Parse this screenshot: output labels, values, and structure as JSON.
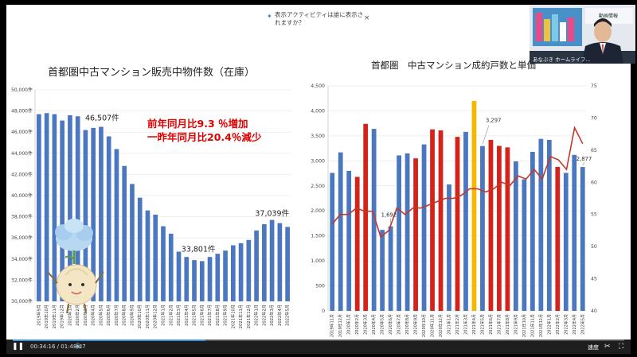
{
  "popup": {
    "text_line1": "表示アクティビティは誰に表示さ",
    "text_line2": "れますか？",
    "close": "×"
  },
  "webcam": {
    "lower_caption": "あなぶき ホームライフ...",
    "screen_text": "動画情報"
  },
  "player": {
    "current_time": "00:34:16",
    "separator": " / ",
    "duration": "01:48:37",
    "speed_label": "速度",
    "progress": 0.315
  },
  "colors": {
    "bar_blue": "#4a77c0",
    "bar_red": "#d3231b",
    "bar_yellow": "#f5b800",
    "line_red": "#c0392b",
    "annotation_red": "#e00000"
  },
  "chart_data": [
    {
      "type": "bar",
      "title": "首都圏中古マンション販売中物件数（在庫）",
      "categories": [
        "2019年9月",
        "2019年10月",
        "2019年11月",
        "2019年12月",
        "2020年1月",
        "2020年2月",
        "2020年3月",
        "2020年4月",
        "2020年5月",
        "2020年6月",
        "2020年7月",
        "2020年8月",
        "2020年9月",
        "2020年10月",
        "2020年11月",
        "2020年12月",
        "2021年1月",
        "2021年2月",
        "2021年3月",
        "2021年4月",
        "2021年5月",
        "2021年6月",
        "2021年7月",
        "2021年8月",
        "2021年9月",
        "2021年10月",
        "2021年11月",
        "2021年12月",
        "2022年1月",
        "2022年2月",
        "2022年3月",
        "2022年4月",
        "2022年5月"
      ],
      "values": [
        47700,
        47800,
        47700,
        47100,
        47600,
        47500,
        46200,
        46400,
        46507,
        45600,
        44400,
        42800,
        41100,
        39800,
        38600,
        38200,
        37100,
        36400,
        34700,
        34200,
        33900,
        33801,
        34200,
        34500,
        34800,
        35300,
        35500,
        35800,
        36700,
        37300,
        37700,
        37400,
        37039
      ],
      "ylim": [
        30000,
        50000
      ],
      "yticks": [
        "30,000件",
        "32,000件",
        "34,000件",
        "36,000件",
        "38,000件",
        "40,000件",
        "42,000件",
        "44,000件",
        "46,000件",
        "48,000件",
        "50,000件"
      ],
      "data_labels": [
        {
          "index": 8,
          "text": "46,507件"
        },
        {
          "index": 21,
          "text": "33,801件"
        },
        {
          "index": 32,
          "text": "37,039件"
        }
      ],
      "annotations": [
        "前年同月比9.3 ％増加",
        "一昨年同月比20.4％減少"
      ]
    },
    {
      "type": "bar",
      "title": "首都圏　中古マンション成約戸数と単価",
      "categories": [
        "2019年11月",
        "2019年12月",
        "2020年1月",
        "2020年2月",
        "2020年3月",
        "2020年4月",
        "2020年5月",
        "2020年6月",
        "2020年7月",
        "2020年8月",
        "2020年9月",
        "2020年10月",
        "2020年11月",
        "2020年12月",
        "2021年1月",
        "2021年2月",
        "2021年3月",
        "2021年4月",
        "2021年5月",
        "2021年6月",
        "2021年7月",
        "2021年8月",
        "2021年9月",
        "2021年10月",
        "2021年11月",
        "2021年12月",
        "2022年1月",
        "2022年2月",
        "2022年3月",
        "2022年4月",
        "2022年5月"
      ],
      "values": [
        2760,
        3170,
        2800,
        2680,
        3740,
        3640,
        1620,
        1692,
        3110,
        3150,
        3050,
        3330,
        3630,
        3610,
        2530,
        3480,
        3580,
        4200,
        3297,
        3420,
        3300,
        3270,
        2990,
        2630,
        3180,
        3440,
        3420,
        2880,
        2760,
        3120,
        2877
      ],
      "bar_colors": [
        "blue",
        "blue",
        "blue",
        "red",
        "red",
        "blue",
        "blue",
        "blue",
        "blue",
        "blue",
        "red",
        "blue",
        "red",
        "red",
        "blue",
        "red",
        "blue",
        "yellow",
        "blue",
        "red",
        "red",
        "red",
        "blue",
        "blue",
        "blue",
        "blue",
        "blue",
        "red",
        "blue",
        "blue",
        "blue"
      ],
      "line_values": [
        53.5,
        55,
        55,
        56,
        55.5,
        55.5,
        51.5,
        52.5,
        56,
        55,
        56,
        56,
        56.5,
        57,
        57.5,
        57.5,
        58,
        59,
        59,
        58.5,
        59,
        60,
        59.5,
        61,
        60.5,
        62,
        60.5,
        64,
        63.5,
        62,
        68.5,
        66
      ],
      "ylim": [
        0,
        4500
      ],
      "y2lim": [
        40,
        75
      ],
      "yticks": [
        "0",
        "500",
        "1,000",
        "1,500",
        "2,000",
        "2,500",
        "3,000",
        "3,500",
        "4,000",
        "4,500"
      ],
      "y2ticks": [
        "40",
        "45",
        "50",
        "55",
        "60",
        "65",
        "70",
        "75"
      ],
      "data_labels": [
        {
          "index": 7,
          "text": "1,692"
        },
        {
          "index": 18,
          "text": "3,297"
        },
        {
          "index": 30,
          "text": "2,877"
        }
      ]
    }
  ]
}
